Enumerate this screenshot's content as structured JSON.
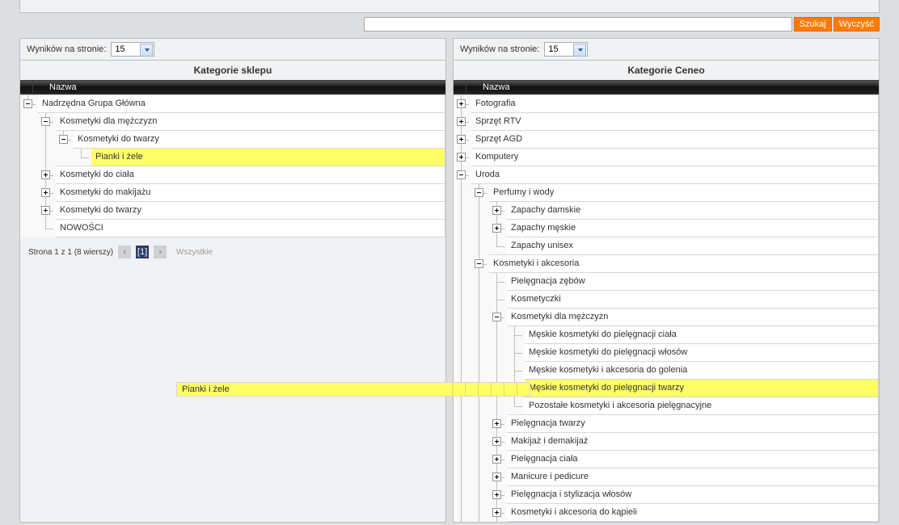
{
  "search": {
    "placeholder": "",
    "btn_search": "Szukaj",
    "btn_clear": "Wyczyść"
  },
  "left": {
    "per_page_label": "Wyników na stronie:",
    "per_page_value": "15",
    "title": "Kategorie sklepu",
    "col_name": "Nazwa",
    "tree": {
      "root": "Nadrzędna Grupa Główna",
      "a": "Kosmetyki dla mężczyzn",
      "a1": "Kosmetyki do twarzy",
      "a1a": "Pianki i żele",
      "b": "Kosmetyki do ciała",
      "c": "Kosmetyki do makijażu",
      "d": "Kosmetyki do twarzy",
      "e": "NOWOŚCI"
    },
    "pager": {
      "info": "Strona 1 z 1 (8 wierszy)",
      "page": "[1]",
      "all": "Wszystkie"
    }
  },
  "right": {
    "per_page_label": "Wyników na stronie:",
    "per_page_value": "15",
    "title": "Kategorie Ceneo",
    "col_name": "Nazwa",
    "tree": {
      "a": "Fotografia",
      "b": "Sprzęt RTV",
      "c": "Sprzęt AGD",
      "d": "Komputery",
      "e": "Uroda",
      "e1": "Perfumy i wody",
      "e1a": "Zapachy damskie",
      "e1b": "Zapachy męskie",
      "e1c": "Zapachy unisex",
      "e2": "Kosmetyki i akcesoria",
      "e2a": "Pielęgnacja zębów",
      "e2b": "Kosmetyczki",
      "e2c": "Kosmetyki dla mężczyzn",
      "e2c1": "Męskie kosmetyki do pielęgnacji ciała",
      "e2c2": "Męskie kosmetyki do pielęgnacji włosów",
      "e2c3": "Męskie kosmetyki i akcesoria do golenia",
      "e2c4": "Męskie kosmetyki do pielęgnacji twarzy",
      "e2c5": "Pozostałe kosmetyki i akcesoria pielęgnacyjne",
      "e2d": "Pielęgnacja twarzy",
      "e2e": "Makijaż i demakijaż",
      "e2f": "Pielęgnacja ciała",
      "e2g": "Manicure i pedicure",
      "e2h": "Pielęgnacja i stylizacja włosów",
      "e2i": "Kosmetyki i akcesoria do kąpieli"
    }
  },
  "connector": {
    "label": "Pianki i żele"
  }
}
